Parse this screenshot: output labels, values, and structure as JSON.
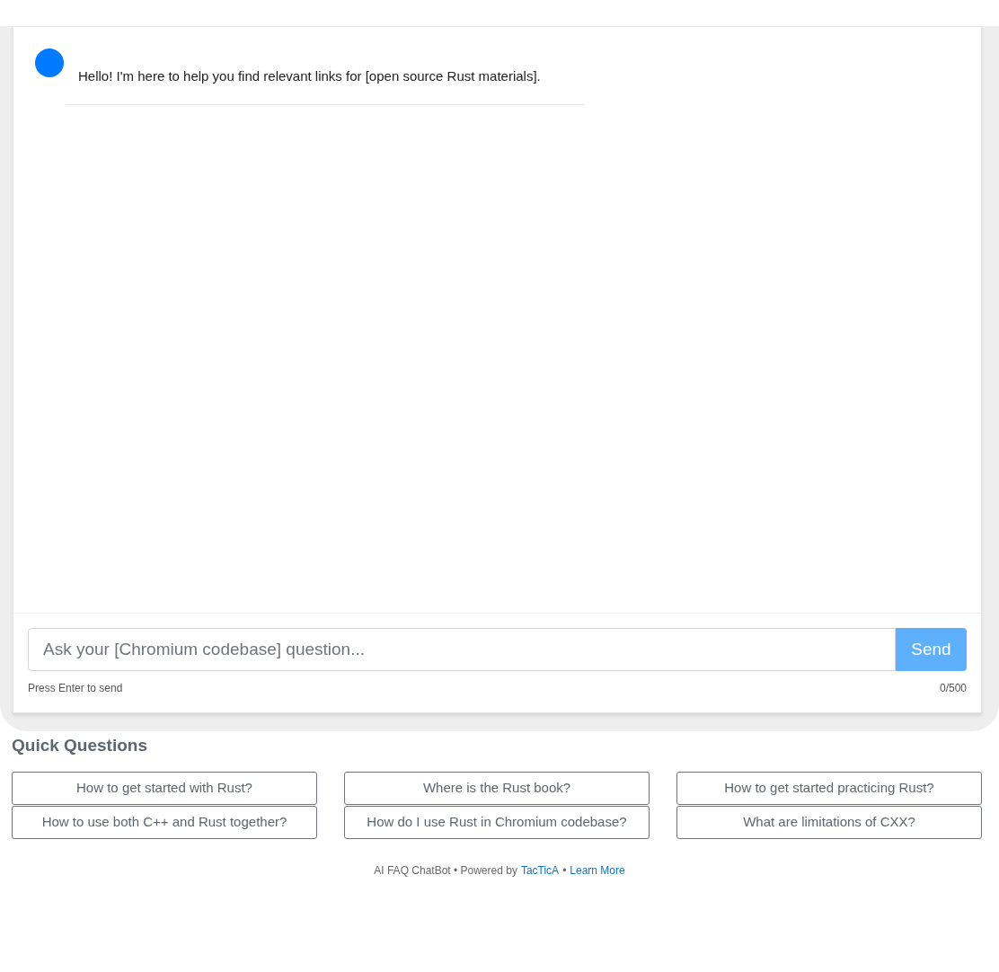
{
  "chat": {
    "messages": [
      {
        "kind": "bot",
        "text": "Hello! I'm here to help you find relevant links for [open source Rust materials]."
      }
    ]
  },
  "composer": {
    "placeholder": "Ask your [Chromium codebase] question...",
    "send_label": "Send",
    "hint": "Press Enter to send",
    "counter": "0/500"
  },
  "quick_questions": {
    "title": "Quick Questions",
    "items": [
      "How to get started with Rust?",
      "Where is the Rust book?",
      "How to get started practicing Rust?",
      "How to use both C++ and Rust together?",
      "How do I use Rust in Chromium codebase?",
      "What are limitations of CXX?"
    ]
  },
  "footer": {
    "text": "AI FAQ ChatBot • Powered by",
    "link": "TacTicA",
    "separator": "•",
    "learn_more": "Learn More"
  }
}
